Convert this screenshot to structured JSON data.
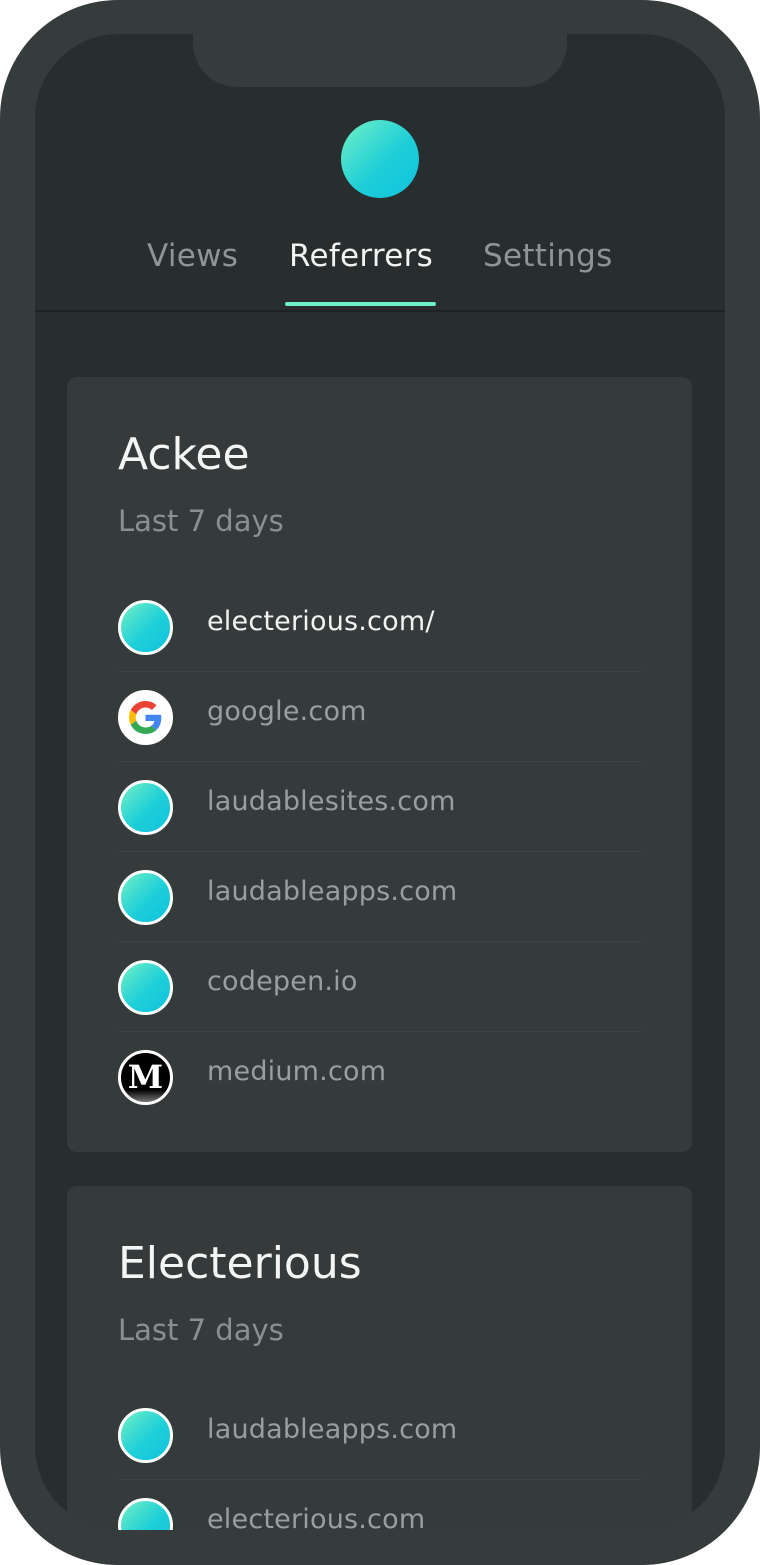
{
  "app": {
    "logo": "ackee-logo-gradient-circle",
    "accent_color": "#6ef0c8"
  },
  "tabs": [
    {
      "label": "Views",
      "active": false
    },
    {
      "label": "Referrers",
      "active": true
    },
    {
      "label": "Settings",
      "active": false
    }
  ],
  "cards": [
    {
      "title": "Ackee",
      "subtitle": "Last 7 days",
      "referrers": [
        {
          "label": "electerious.com/",
          "icon": "gradient-circle-icon",
          "highlighted": true
        },
        {
          "label": "google.com",
          "icon": "google-icon",
          "highlighted": false
        },
        {
          "label": "laudablesites.com",
          "icon": "gradient-circle-icon",
          "highlighted": false
        },
        {
          "label": "laudableapps.com",
          "icon": "gradient-circle-icon",
          "highlighted": false
        },
        {
          "label": "codepen.io",
          "icon": "gradient-circle-icon",
          "highlighted": false
        },
        {
          "label": "medium.com",
          "icon": "medium-icon",
          "highlighted": false
        }
      ]
    },
    {
      "title": "Electerious",
      "subtitle": "Last 7 days",
      "referrers": [
        {
          "label": "laudableapps.com",
          "icon": "gradient-circle-icon",
          "highlighted": false
        },
        {
          "label": "electerious.com",
          "icon": "gradient-circle-icon",
          "highlighted": false
        }
      ]
    }
  ]
}
